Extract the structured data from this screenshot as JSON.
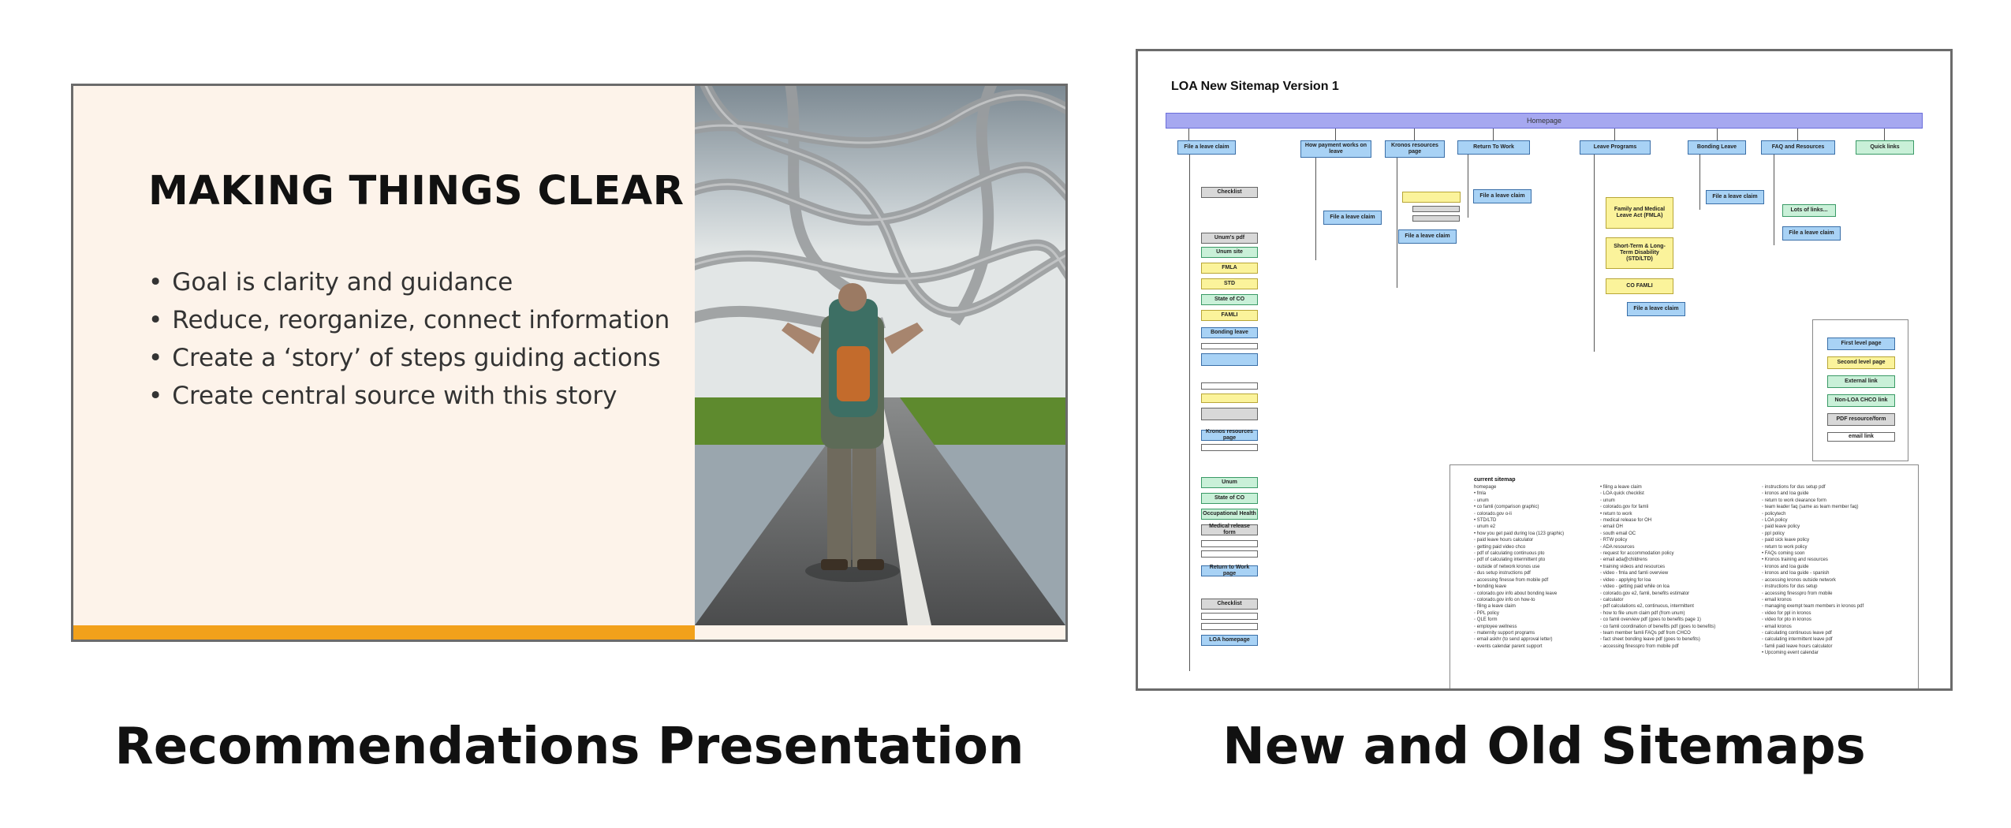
{
  "slide": {
    "title": "MAKING THINGS CLEAR",
    "bullets": [
      "Goal is clarity and guidance",
      "Reduce, reorganize, connect information",
      "Create a ‘story’ of steps guiding actions",
      "Create central source with this story"
    ]
  },
  "captions": {
    "left": "Recommendations Presentation",
    "right": "New and Old Sitemaps"
  },
  "sitemap": {
    "title": "LOA New Sitemap Version 1",
    "homepage": "Homepage",
    "top_nodes": [
      "File a leave claim",
      "How payment works on leave",
      "Kronos resources page",
      "Return To Work",
      "Leave Programs",
      "Bonding Leave",
      "FAQ and Resources",
      "Quick links"
    ],
    "file_claim_label": "File a leave claim",
    "programs": [
      "Family and Medical Leave Act (FMLA)",
      "Short-Term & Long-Term Disability (STD/LTD)",
      "CO FAMLI"
    ],
    "col1_items": [
      "Checklist",
      "Unum's pdf",
      "Unum site",
      "FMLA",
      "STD",
      "State of CO",
      "FAMLI",
      "Bonding leave",
      "Kronos resources page",
      "Unum",
      "State of CO",
      "Occupational Health",
      "Medical release form",
      "Return to Work page",
      "Checklist",
      "LOA homepage"
    ],
    "faq_sub": "Lots of links...",
    "legend": [
      "First level page",
      "Second level page",
      "External link",
      "Non-LOA CHCO link",
      "PDF resource/form",
      "email link"
    ],
    "current_title": "current sitemap",
    "current_col1": [
      "homepage",
      "• fmla",
      "◦ unum",
      "• co famli (comparison graphic)",
      "◦ colorado.gov o-li",
      "• STD/LTD",
      "◦ unum e2",
      "• how you get paid during loa (123 graphic)",
      "◦ paid leave hours calculator",
      "◦ getting paid video chco",
      "◦ pdf of calculating continuous pto",
      "◦ pdf of calculating intermittent pto",
      "◦ outside of network kronos use",
      "◦ dus setup instructions pdf",
      "◦ accessing finesse from mobile pdf",
      "• bonding leave",
      "◦ colorado.gov info about bonding leave",
      "◦ colorado.gov info on how-to",
      "◦ filing a leave claim",
      "◦ PPL policy",
      "◦ QLE form",
      "◦ employee wellness",
      "◦ maternity support programs",
      "◦ email askhr (to send approval letter)",
      "◦ events calendar parent support"
    ],
    "current_col2": [
      "• filing a leave claim",
      "◦ LOA quick checklist",
      "◦ unum",
      "◦ colorado.gov for famli",
      "• return to work",
      "◦ medical release for OH",
      "◦ email OH",
      "◦ south email OC",
      "◦ RTW policy",
      "◦ ADA resources",
      "◦ request for accommodation policy",
      "◦ email ada@childrens",
      "• training videos and resources",
      "◦ video - fmla and famli overview",
      "◦ video - applying for loa",
      "◦ video - getting paid while on loa",
      "◦ colorado.gov e2, famli, benefits estimator",
      "◦ calculator",
      "◦ pdf calculations e2, continuous, intermittent",
      "◦ how to file unum claim pdf (from unum)",
      "◦ co famli overview pdf (goes to benefits page 1)",
      "◦ co famli coordination of benefits pdf (goes to benefits)",
      "◦ team member famli FAQs pdf from CHCO",
      "◦ fact sheet bonding leave pdf (goes to benefits)",
      "◦ accessing finesspro from mobile pdf"
    ],
    "current_col3": [
      "◦ instructions for dus setup pdf",
      "◦ kronos and loa guide",
      "◦ return to work clearance form",
      "◦ team leader faq (same as team member faq)",
      "◦ policytech",
      "◦ LOA policy",
      "◦ paid leave policy",
      "◦ ppl policy",
      "◦ paid sick leave policy",
      "◦ return to work policy",
      "• FAQs coming soon",
      "• Kronos training and resources",
      "◦ kronos and loa guide",
      "◦ kronos and loa guide - spanish",
      "◦ accessing kronos outside network",
      "◦ instructions for dus setup",
      "◦ accessing finesspro from mobile",
      "◦ email kronos",
      "◦ managing exempt team members in kronos pdf",
      "◦ video for ppl in kronos",
      "◦ video for pto in kronos",
      "◦ email kronos",
      "◦ calculating continuous leave pdf",
      "◦ calculating intermittent leave pdf",
      "◦ famli paid leave hours calculator",
      "• Upcoming event calendar"
    ]
  }
}
